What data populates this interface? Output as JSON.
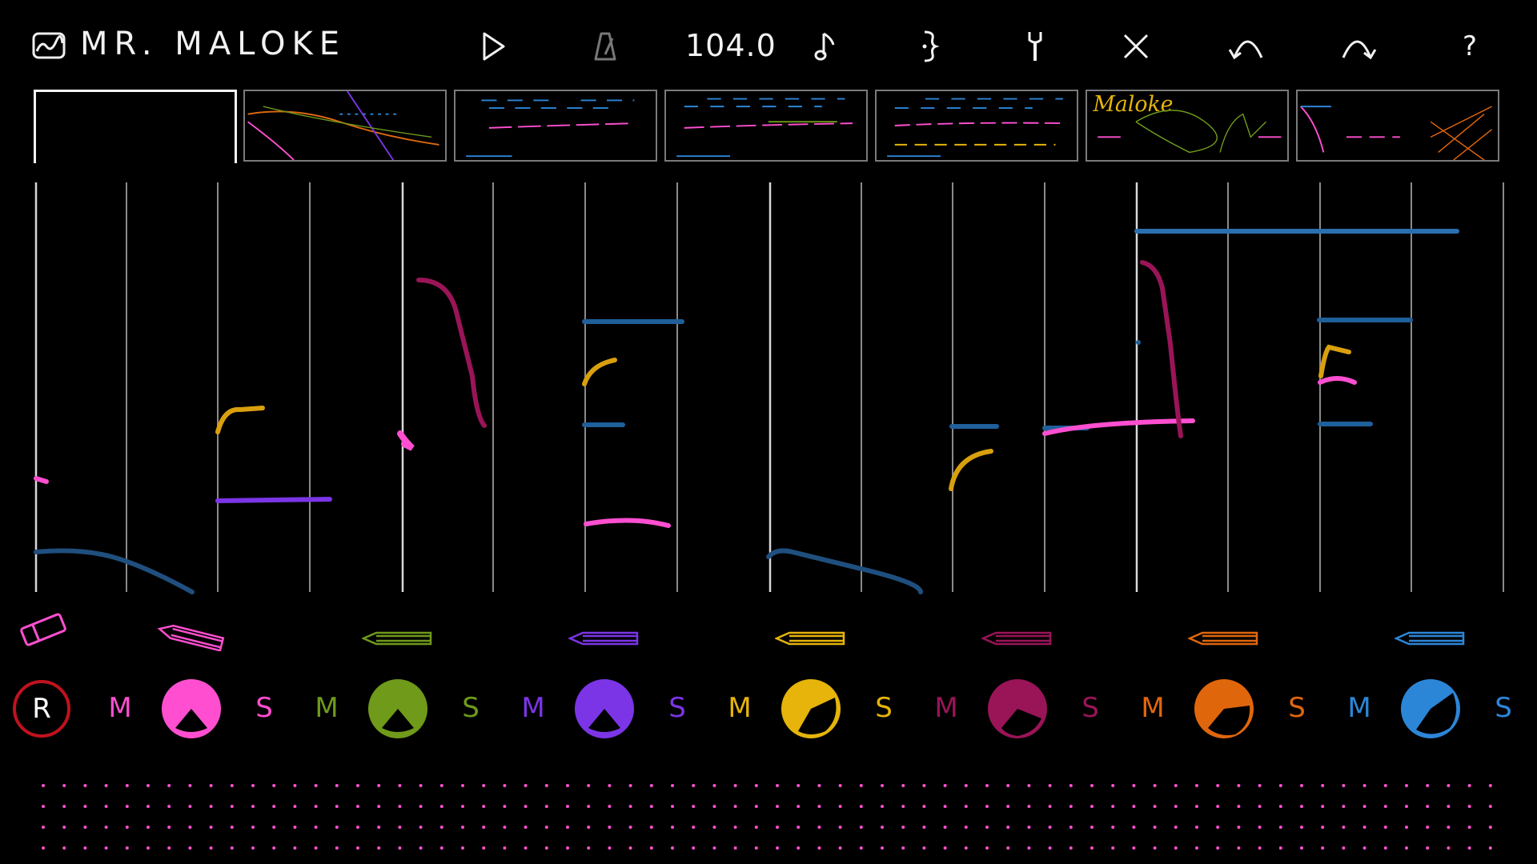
{
  "app": {
    "title": "MR. MALOKE",
    "logo_icon": "waveform-box-icon"
  },
  "toolbar": {
    "tempo": "104.0",
    "buttons": [
      {
        "name": "play-icon"
      },
      {
        "name": "metronome-icon"
      },
      {
        "name": "note-icon"
      },
      {
        "name": "loop-bracket-icon"
      },
      {
        "name": "wrench-icon"
      },
      {
        "name": "close-icon"
      },
      {
        "name": "undo-icon"
      },
      {
        "name": "redo-icon"
      },
      {
        "name": "help-icon"
      }
    ],
    "help_label": "?"
  },
  "patterns": {
    "count": 7,
    "selected": 0,
    "thumb_text_6": "Maloke"
  },
  "tools": {
    "eraser": "eraser-icon",
    "pencils": [
      "pink",
      "green",
      "purple",
      "yellow",
      "magenta",
      "orange",
      "blue"
    ]
  },
  "record": {
    "label": "R",
    "color": "#c0121e"
  },
  "tracks": [
    {
      "color": "#ff4fd0",
      "mute": "M",
      "solo": "S"
    },
    {
      "color": "#6f9a1a",
      "mute": "M",
      "solo": "S"
    },
    {
      "color": "#7b35e6",
      "mute": "M",
      "solo": "S"
    },
    {
      "color": "#e6b40a",
      "mute": "M",
      "solo": "S"
    },
    {
      "color": "#9a1458",
      "mute": "M",
      "solo": "S"
    },
    {
      "color": "#e0660c",
      "mute": "M",
      "solo": "S"
    },
    {
      "color": "#2c86d8",
      "mute": "M",
      "solo": "S"
    }
  ]
}
